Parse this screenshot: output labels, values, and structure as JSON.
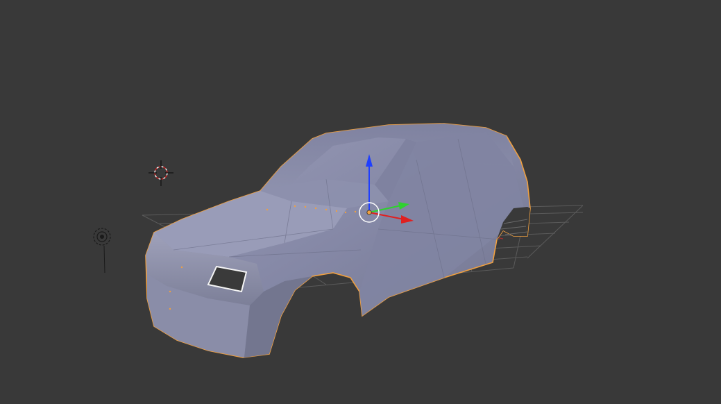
{
  "viewport": {
    "background": "#393939",
    "grid_color": "#5a5a5a",
    "x_axis_color": "#b03030"
  },
  "scene_objects": {
    "car_body": {
      "name": "car-body-mesh",
      "selected": true,
      "outline_color": "#f0a040",
      "fill_color": "#8a8ea8"
    },
    "camera_lamp": {
      "name": "lamp-object"
    },
    "cursor_3d": {
      "name": "3d-cursor"
    }
  },
  "gizmo": {
    "z_color": "#1f3fff",
    "y_color": "#2fd12f",
    "x_color": "#e02020",
    "origin_color": "#f0a040"
  }
}
